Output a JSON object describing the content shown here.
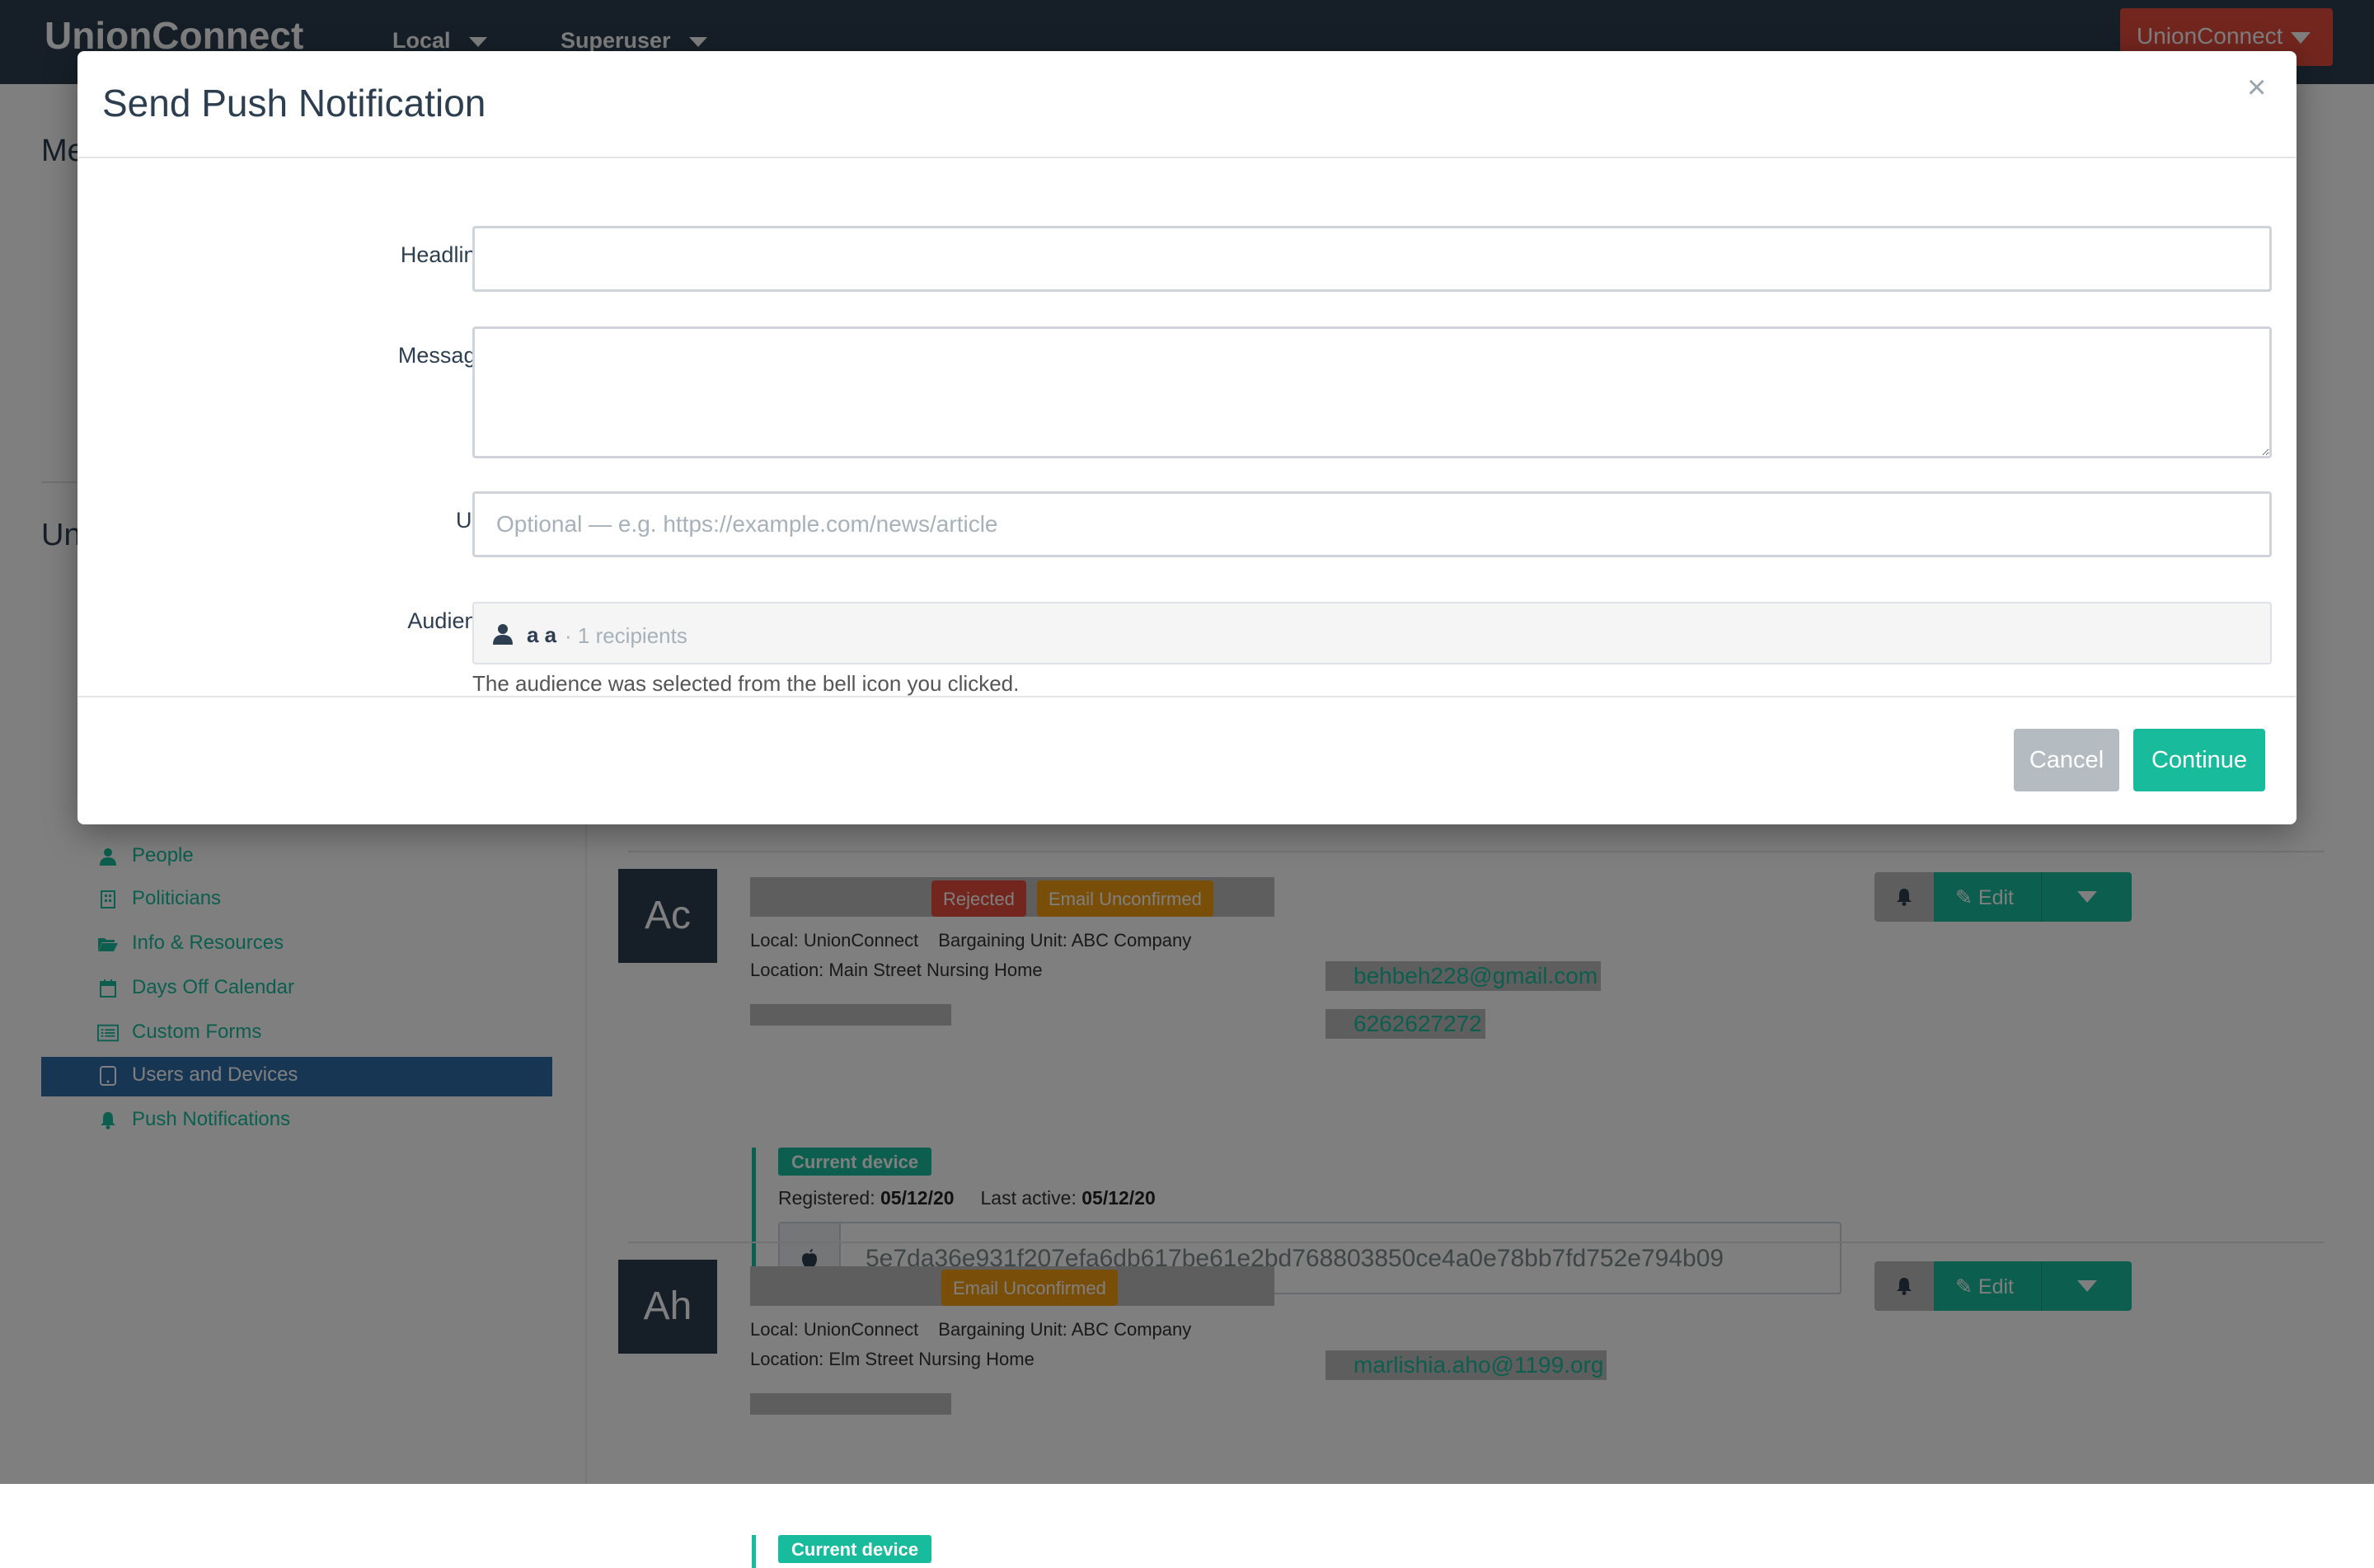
{
  "app": {
    "brand": "UnionConnect",
    "nav": [
      {
        "label": "Local"
      },
      {
        "label": "Superuser"
      }
    ],
    "account_button": "UnionConnect"
  },
  "sidebar": {
    "heading_fragment": "Me",
    "section_fragment": "Un",
    "items": [
      {
        "label": "People",
        "icon": "user-icon",
        "active": false
      },
      {
        "label": "Politicians",
        "icon": "building-icon",
        "active": false
      },
      {
        "label": "Info & Resources",
        "icon": "folder-open-icon",
        "active": false
      },
      {
        "label": "Days Off Calendar",
        "icon": "calendar-icon",
        "active": false
      },
      {
        "label": "Custom Forms",
        "icon": "list-icon",
        "active": false
      },
      {
        "label": "Users and Devices",
        "icon": "tablet-icon",
        "active": true
      },
      {
        "label": "Push Notifications",
        "icon": "bell-icon",
        "active": false
      }
    ]
  },
  "users": [
    {
      "initials": "Ac",
      "badges": [
        {
          "label": "Rejected",
          "color": "#e74c3c"
        },
        {
          "label": "Email Unconfirmed",
          "color": "#f39c12"
        }
      ],
      "local_label": "Local:",
      "local": "UnionConnect",
      "bargaining_label": "Bargaining Unit:",
      "bargaining_unit": "ABC Company",
      "location_label": "Location:",
      "location": "Main Street Nursing Home",
      "email": "behbeh228@gmail.com",
      "phone": "6262627272",
      "edit_label": "Edit",
      "device": {
        "badge": "Current device",
        "registered_label": "Registered:",
        "registered": "05/12/20",
        "last_active_label": "Last active:",
        "last_active": "05/12/20",
        "platform_icon": "apple-icon",
        "token": "5e7da36e931f207efa6db617be61e2bd768803850ce4a0e78bb7fd752e794b09"
      }
    },
    {
      "initials": "Ah",
      "badges": [
        {
          "label": "Email Unconfirmed",
          "color": "#f39c12"
        }
      ],
      "local_label": "Local:",
      "local": "UnionConnect",
      "bargaining_label": "Bargaining Unit:",
      "bargaining_unit": "ABC Company",
      "location_label": "Location:",
      "location": "Elm Street Nursing Home",
      "email": "marlishia.aho@1199.org",
      "edit_label": "Edit",
      "device": {
        "badge": "Current device"
      }
    }
  ],
  "modal": {
    "title": "Send Push Notification",
    "close_symbol": "×",
    "fields": {
      "headline": {
        "label": "Headline",
        "required_mark": "*",
        "value": ""
      },
      "message": {
        "label": "Message",
        "required_mark": "*",
        "value": ""
      },
      "url": {
        "label": "URL",
        "value": "",
        "placeholder": "Optional — e.g. https://example.com/news/article"
      },
      "audience": {
        "label": "Audience",
        "icon": "user-icon",
        "name": "a a",
        "count_text": "· 1 recipients",
        "help": "The audience was selected from the bell icon you clicked."
      }
    },
    "buttons": {
      "cancel": "Cancel",
      "continue": "Continue"
    }
  },
  "colors": {
    "navbar": "#2c3e50",
    "accent": "#18bc9c",
    "danger": "#e74c3c",
    "warning": "#f39c12",
    "active_nav": "#2c6ca8",
    "muted_button": "#b4bcc2"
  }
}
